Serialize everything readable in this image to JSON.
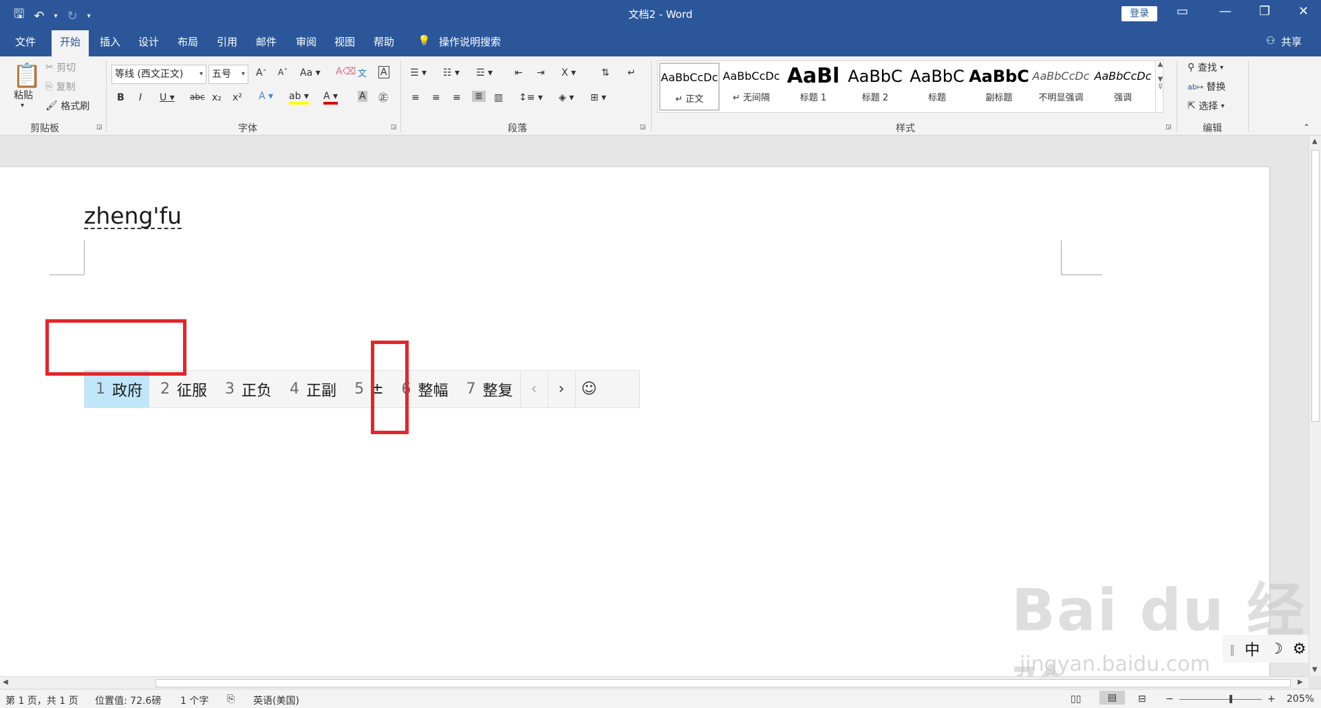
{
  "titlebar": {
    "title": "文档2  -  Word",
    "login": "登录",
    "qat": {
      "save_icon": "save-icon",
      "undo_icon": "undo-icon",
      "redo_icon": "redo-icon",
      "customize_icon": "customize-icon"
    }
  },
  "tabs": [
    "文件",
    "开始",
    "插入",
    "设计",
    "布局",
    "引用",
    "邮件",
    "审阅",
    "视图",
    "帮助"
  ],
  "active_tab": "开始",
  "tell_me": "操作说明搜索",
  "share": "共享",
  "clipboard": {
    "paste": "粘贴",
    "cut": "剪切",
    "copy": "复制",
    "format_painter": "格式刷",
    "label": "剪贴板"
  },
  "font": {
    "family": "等线 (西文正文)",
    "size": "五号",
    "label": "字体"
  },
  "paragraph": {
    "label": "段落"
  },
  "styles": {
    "label": "样式",
    "items": [
      {
        "preview": "AaBbCcDc",
        "name": "↵ 正文"
      },
      {
        "preview": "AaBbCcDc",
        "name": "↵ 无间隔"
      },
      {
        "preview": "AaBl",
        "name": "标题 1"
      },
      {
        "preview": "AaBbC",
        "name": "标题 2"
      },
      {
        "preview": "AaBbC",
        "name": "标题"
      },
      {
        "preview": "AaBbC",
        "name": "副标题"
      },
      {
        "preview": "AaBbCcDc",
        "name": "不明显强调"
      },
      {
        "preview": "AaBbCcDc",
        "name": "强调"
      }
    ]
  },
  "editing": {
    "find": "查找",
    "replace": "替换",
    "select": "选择",
    "label": "编辑"
  },
  "document": {
    "typed_text": "zheng'fu"
  },
  "ime": {
    "candidates": [
      {
        "num": "1",
        "text": "政府"
      },
      {
        "num": "2",
        "text": "征服"
      },
      {
        "num": "3",
        "text": "正负"
      },
      {
        "num": "4",
        "text": "正副"
      },
      {
        "num": "5",
        "text": "±"
      },
      {
        "num": "6",
        "text": "整幅"
      },
      {
        "num": "7",
        "text": "整复"
      }
    ],
    "prev": "‹",
    "next": "›",
    "emoji": "☺",
    "mode": "中",
    "moon": "☽",
    "gear": "⚙"
  },
  "watermark": {
    "main": "Bai du 经验",
    "sub": "jingyan.baidu.com"
  },
  "statusbar": {
    "page": "第 1 页，共 1 页",
    "position": "位置值: 72.6磅",
    "words": "1 个字",
    "language": "英语(美国)",
    "zoom_minus": "−",
    "zoom_plus": "+",
    "zoom": "205%"
  }
}
